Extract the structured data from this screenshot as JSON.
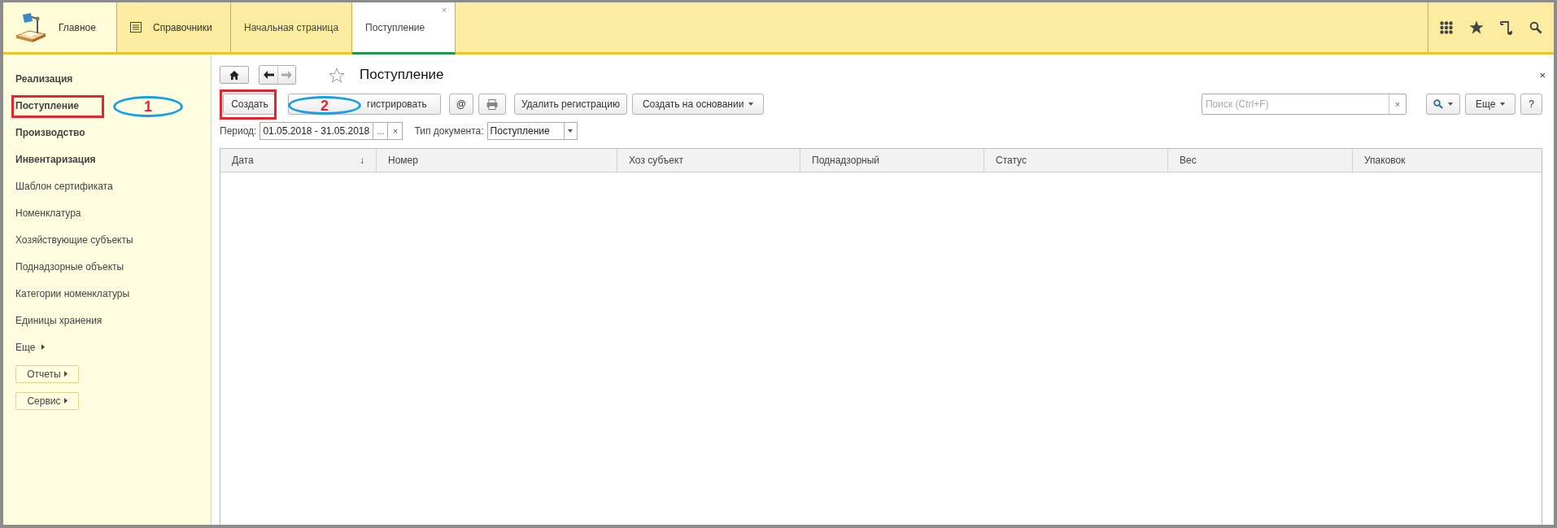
{
  "top_bar": {
    "sections": [
      {
        "label": "Главное",
        "kind": "home"
      },
      {
        "label": "Справочники",
        "kind": "catalog"
      }
    ],
    "tabs": [
      {
        "label": "Начальная страница",
        "selected": false
      },
      {
        "label": "Поступление",
        "selected": true,
        "close": "×"
      }
    ]
  },
  "sidebar": {
    "items": [
      {
        "label": "Реализация",
        "kind": "section"
      },
      {
        "label": "Поступление",
        "kind": "section",
        "callout": "1"
      },
      {
        "label": "Производство",
        "kind": "section"
      },
      {
        "label": "Инвентаризация",
        "kind": "section"
      },
      {
        "label": "Шаблон сертификата",
        "kind": "link"
      },
      {
        "label": "Номенклатура",
        "kind": "link"
      },
      {
        "label": "Хозяйствующие субъекты",
        "kind": "link"
      },
      {
        "label": "Поднадзорные объекты",
        "kind": "link"
      },
      {
        "label": "Категории номенклатуры",
        "kind": "link"
      },
      {
        "label": "Единицы хранения",
        "kind": "link"
      },
      {
        "label": "Еще",
        "kind": "more"
      },
      {
        "label": "Отчеты",
        "kind": "button"
      },
      {
        "label": "Сервис",
        "kind": "button"
      }
    ]
  },
  "form": {
    "title": "Поступление",
    "close": "×",
    "toolbar": [
      {
        "kind": "button",
        "label": "Создать",
        "callout": "2"
      },
      {
        "kind": "wide",
        "label": "гистрировать"
      },
      {
        "kind": "button",
        "label": "@"
      },
      {
        "kind": "print"
      },
      {
        "kind": "button",
        "label": "Удалить регистрацию"
      },
      {
        "kind": "menu",
        "label": "Создать на основании"
      }
    ],
    "search": {
      "placeholder": "Поиск (Ctrl+F)",
      "clear": "×"
    },
    "toolbar_right": [
      {
        "kind": "search-menu"
      },
      {
        "kind": "menu",
        "label": "Еще"
      },
      {
        "kind": "button",
        "label": "?"
      }
    ],
    "filters": {
      "period_label": "Период:",
      "period_value": "01.05.2018 - 31.05.2018",
      "period_select": "...",
      "period_clear": "×",
      "type_label": "Тип документа:",
      "type_value": "Поступление"
    },
    "table": {
      "columns": [
        {
          "label": "Дата",
          "sort": "↓"
        },
        {
          "label": "Номер"
        },
        {
          "label": "Хоз субъект"
        },
        {
          "label": "Поднадзорный"
        },
        {
          "label": "Статус"
        },
        {
          "label": "Вес"
        },
        {
          "label": "Упаковок"
        }
      ]
    }
  }
}
